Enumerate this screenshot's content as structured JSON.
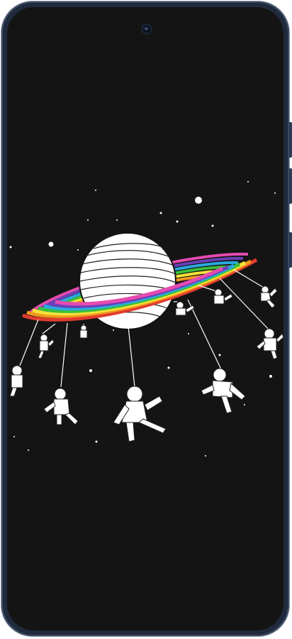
{
  "device": {
    "frame_color": "#1f2a3d",
    "screen_color": "#141414"
  },
  "wallpaper": {
    "subject": "saturn-with-rainbow-rings-and-astronauts",
    "planet_color": "#ffffff",
    "ring_colors": [
      "#e23b2e",
      "#f29a1f",
      "#f6e33a",
      "#3cbf3a",
      "#2aa9e0",
      "#6b3fb8",
      "#e54bb0"
    ],
    "astronaut_count": 11
  }
}
